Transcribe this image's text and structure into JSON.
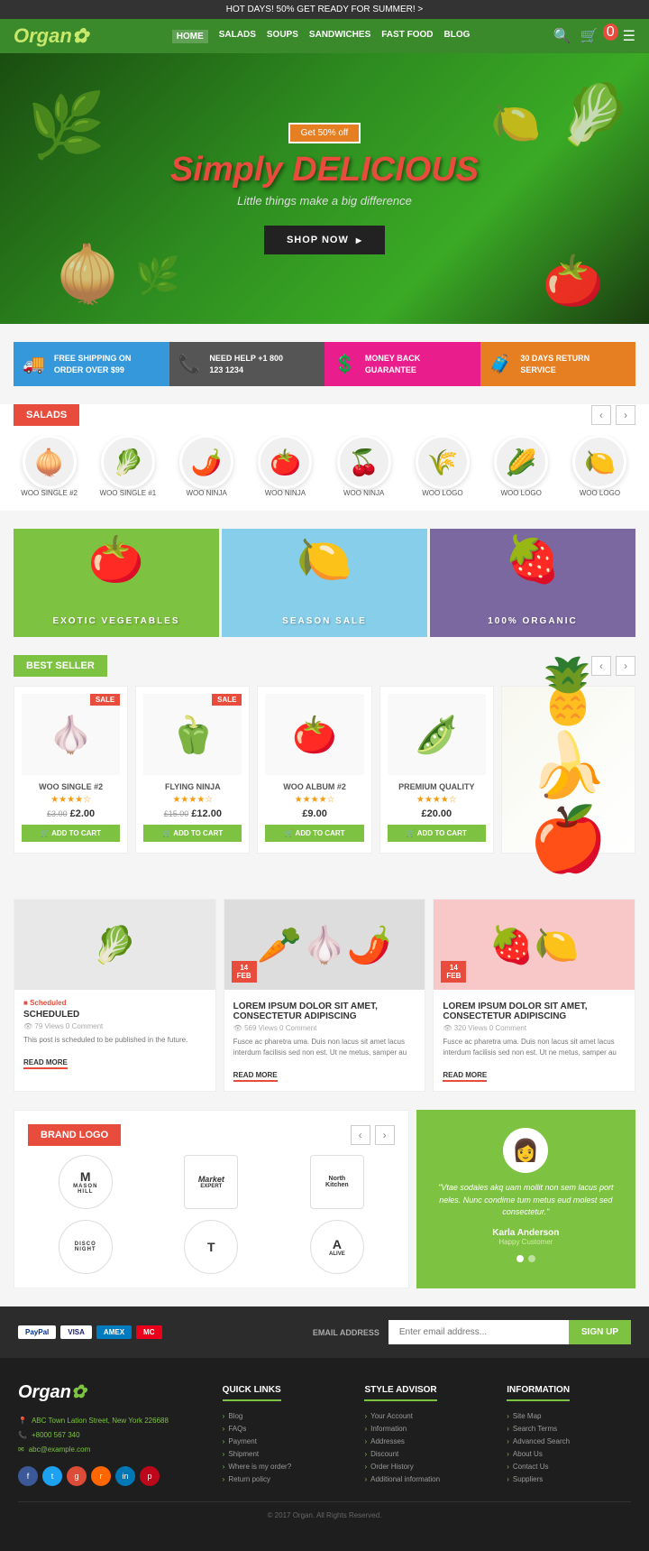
{
  "topbar": {
    "text": "HOT DAYS!  50% GET READY FOR SUMMER! >"
  },
  "header": {
    "logo": "Organ",
    "nav": [
      "HOME",
      "SALADS",
      "SOUPS",
      "SANDWICHES",
      "FAST FOOD",
      "BLOG"
    ]
  },
  "hero": {
    "badge": "Get 50% off",
    "title_regular": "Simply",
    "title_accent": "DELICIOUS",
    "subtitle": "Little things make a big difference",
    "cta": "SHOP NOW"
  },
  "features": [
    {
      "icon": "🚚",
      "line1": "FREE SHIPPING ON",
      "line2": "ORDER OVER $99"
    },
    {
      "icon": "📞",
      "line1": "NEED HELP +1 800",
      "line2": "123 1234"
    },
    {
      "icon": "$",
      "line1": "MONEY BACK",
      "line2": "GUARANTEE"
    },
    {
      "icon": "🧳",
      "line1": "30 DAYS RETURN",
      "line2": "SERVICE"
    }
  ],
  "salads_section": {
    "title": "SALADS",
    "items": [
      {
        "emoji": "🧅",
        "name": "WOO SINGLE #2"
      },
      {
        "emoji": "🥬",
        "name": "WOO SINGLE #1"
      },
      {
        "emoji": "🌶️",
        "name": "WOO NINJA"
      },
      {
        "emoji": "🍅",
        "name": "WOO NINJA"
      },
      {
        "emoji": "🍒",
        "name": "WOO NINJA"
      },
      {
        "emoji": "🌾",
        "name": "WOO LOGO"
      },
      {
        "emoji": "🌽",
        "name": "WOO LOGO"
      },
      {
        "emoji": "🍋",
        "name": "WOO LOGO"
      }
    ]
  },
  "promo_banners": [
    {
      "label": "EXOTIC VEGETABLES",
      "emoji": "🍅",
      "bg": "#7dc240"
    },
    {
      "label": "SEASON SALE",
      "emoji": "🍋",
      "bg": "#87ceeb"
    },
    {
      "label": "100% ORGANIC",
      "emoji": "🍓",
      "bg": "#7b68a0"
    }
  ],
  "best_seller": {
    "title": "BEST SELLER",
    "products": [
      {
        "emoji": "🧄",
        "name": "WOO SINGLE #2",
        "stars": 4,
        "old_price": "£3.00",
        "new_price": "£2.00",
        "sale": true
      },
      {
        "emoji": "🫑",
        "name": "FLYING NINJA",
        "stars": 4,
        "old_price": "£15.00",
        "new_price": "£12.00",
        "sale": true
      },
      {
        "emoji": "🍅",
        "name": "WOO ALBUM #2",
        "stars": 4,
        "old_price": null,
        "new_price": "£9.00",
        "sale": false
      },
      {
        "emoji": "🫛",
        "name": "PREMIUM QUALITY",
        "stars": 4,
        "old_price": null,
        "new_price": "£20.00",
        "sale": false
      }
    ],
    "add_to_cart": "ADD TO CART"
  },
  "blog": {
    "posts": [
      {
        "emoji": "🥬",
        "tag": "Scheduled",
        "date_day": null,
        "date_month": null,
        "title": "SCHEDULED",
        "meta": "79 Views   0 Comment",
        "excerpt": "This post is scheduled to be published in the future.",
        "read_more": "READ MORE",
        "has_date": false
      },
      {
        "emoji": "🥕",
        "tag": "",
        "date_day": "14",
        "date_month": "FEB",
        "title": "LOREM IPSUM DOLOR SIT AMET, CONSECTETUR ADIPISCING",
        "meta": "569 Views   0 Comment",
        "excerpt": "Fusce ac pharetra uma. Duis non lacus sit amet lacus interdum facilisis sed non est. Ut ne metus, samper au",
        "read_more": "READ MORE",
        "has_date": true
      },
      {
        "emoji": "🍓",
        "tag": "",
        "date_day": "14",
        "date_month": "FEB",
        "title": "LOREM IPSUM DOLOR SIT AMET, CONSECTETUR ADIPISCING",
        "meta": "320 Views   0 Comment",
        "excerpt": "Fusce ac pharetra uma. Duis non lacus sit amet lacus interdum facilisis sed non est. Ut ne metus, samper au",
        "read_more": "READ MORE",
        "has_date": true
      }
    ]
  },
  "brand_section": {
    "title": "BRAND LOGO",
    "logos": [
      {
        "text": "M",
        "sub": "MASON HILL"
      },
      {
        "text": "Market",
        "sub": "EXPERT"
      },
      {
        "text": "North Kitchen",
        "sub": ""
      },
      {
        "text": "D",
        "sub": "DISCO NIGHT"
      },
      {
        "text": "T",
        "sub": ""
      },
      {
        "text": "A",
        "sub": "ALIVE"
      }
    ]
  },
  "testimonial": {
    "quote": "\"Vtae sodales akq uam mollit non sem lacus port neles. Nunc condime tum metus eud molest sed consectetur.\"",
    "author": "Karla Anderson",
    "role": "Happy Customer"
  },
  "footer_signup": {
    "label": "EMAIL ADDRESS",
    "placeholder": "Enter email address...",
    "button": "SIGN UP"
  },
  "footer": {
    "logo": "Organ",
    "address": "ABC Town Lation Street, New York 226688",
    "phone": "+8000 567 340",
    "email": "abc@example.com",
    "quick_links": {
      "title": "QUICK LINKS",
      "items": [
        "Blog",
        "FAQs",
        "Payment",
        "Shipment",
        "Where is my order?",
        "Return policy"
      ]
    },
    "style_advisor": {
      "title": "STYLE ADVISOR",
      "items": [
        "Your Account",
        "Information",
        "Addresses",
        "Discount",
        "Order History",
        "Additional information"
      ]
    },
    "information": {
      "title": "INFORMATION",
      "items": [
        "Site Map",
        "Search Terms",
        "Advanced Search",
        "About Us",
        "Contact Us",
        "Suppliers"
      ]
    },
    "copyright": "© 2017 Organ. All Rights Reserved."
  },
  "payment_methods": [
    "PayPal",
    "VISA",
    "AMEX",
    "MC"
  ]
}
